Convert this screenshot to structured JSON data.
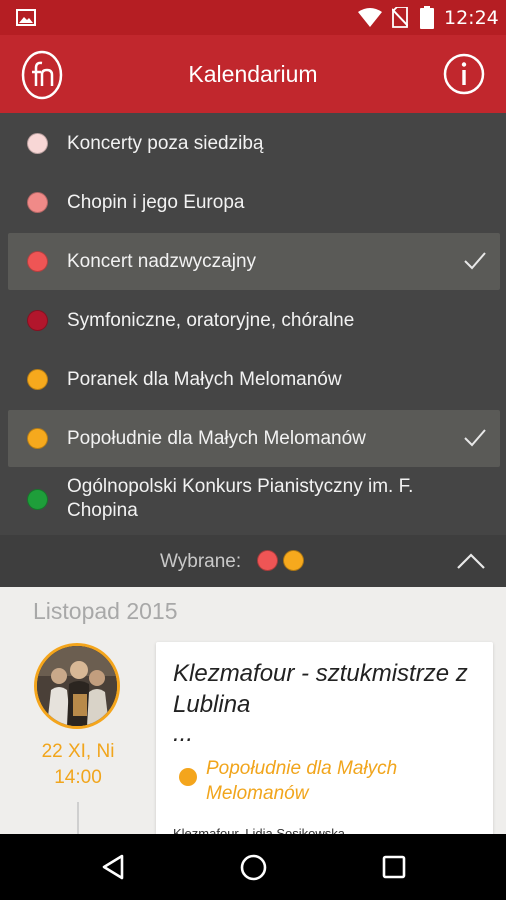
{
  "status_bar": {
    "time": "12:24",
    "icons": [
      "gallery-icon",
      "wifi-icon",
      "no-sim-icon",
      "battery-icon"
    ]
  },
  "app_bar": {
    "title": "Kalendarium",
    "logo_icon": "filharmonia-logo",
    "info_icon": "info-icon"
  },
  "filters": [
    {
      "label": "Koncerty poza siedzibą",
      "color": "#f8d7d6",
      "selected": false
    },
    {
      "label": "Chopin i jego Europa",
      "color": "#f08a88",
      "selected": false
    },
    {
      "label": "Koncert nadzwyczajny",
      "color": "#ef5555",
      "selected": true
    },
    {
      "label": "Symfoniczne, oratoryjne, chóralne",
      "color": "#b2162c",
      "selected": false
    },
    {
      "label": "Poranek dla Małych Melomanów",
      "color": "#f6a91d",
      "selected": false
    },
    {
      "label": "Popołudnie dla Małych Melomanów",
      "color": "#f6a91d",
      "selected": true
    },
    {
      "label": "Ogólnopolski Konkurs Pianistyczny im. F. Chopina",
      "color": "#1e9e3a",
      "selected": false
    }
  ],
  "selected_bar": {
    "label": "Wybrane:",
    "colors": [
      "#ef5555",
      "#f6a91d"
    ]
  },
  "month": "Listopad 2015",
  "event": {
    "date": "22 XI, Ni",
    "time": "14:00",
    "title": "Klezmafour - sztukmistrze z Lublina",
    "ellipsis": "...",
    "category": "Popołudnie dla Małych Melomanów",
    "category_color": "#f4a51c",
    "description": "Klezmafour, Lidia Sosikowska"
  },
  "colors": {
    "brand_red": "#c1272d",
    "panel_dark": "#454545",
    "accent_orange": "#f1a51c"
  }
}
